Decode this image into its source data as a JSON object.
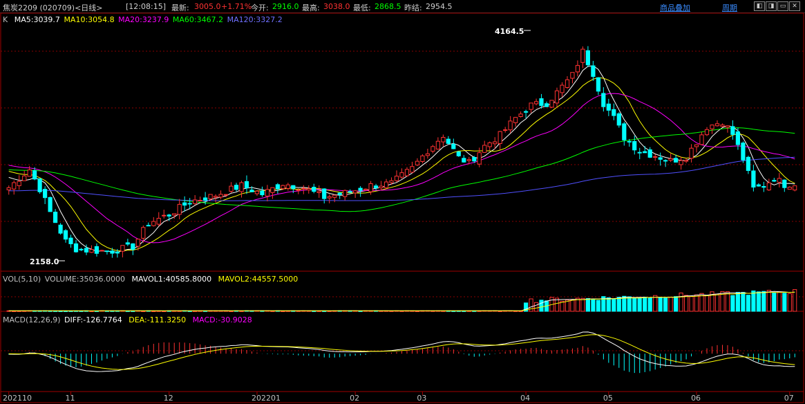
{
  "header": {
    "symbol": "焦炭2209 (020709)<日线>",
    "time": "[12:08:15]",
    "latest_label": "最新:",
    "latest_value": "3005.0",
    "change": "+1.71%",
    "open_label": "今开:",
    "open_value": "2916.0",
    "high_label": "最高:",
    "high_value": "3038.0",
    "low_label": "最低:",
    "low_value": "2868.5",
    "prev_label": "昨结:",
    "prev_value": "2954.5",
    "overlay_button": "商品叠加",
    "period_button": "周期",
    "window_buttons": [
      "◧",
      "◨",
      "▭",
      "✕"
    ]
  },
  "colors": {
    "up": "#ff3232",
    "down": "#00ffff",
    "ma5": "#ffffff",
    "ma10": "#ffff00",
    "ma20": "#ff00ff",
    "ma60": "#00ff00",
    "ma120": "#5050ff",
    "grid": "#8b0000"
  },
  "main_legend": {
    "k": "K",
    "ma5": "MA5:3039.7",
    "ma10": "MA10:3054.8",
    "ma20": "MA20:3237.9",
    "ma60": "MA60:3467.2",
    "ma120": "MA120:3327.2"
  },
  "vol_legend": {
    "name": "VOL(5,10)",
    "volume": "VOLUME:35036.0000",
    "mavol1": "MAVOL1:40585.8000",
    "mavol2": "MAVOL2:44557.5000"
  },
  "macd_legend": {
    "name": "MACD(12,26,9)",
    "diff": "DIFF:-126.7764",
    "dea": "DEA:-111.3250",
    "macd": "MACD:-30.9028"
  },
  "chart_data": {
    "type": "candlestick",
    "price_high_label": "4164.5",
    "price_low_label": "2158.0",
    "ylim": [
      2050,
      4350
    ],
    "x_labels": [
      "202110",
      "11",
      "12",
      "202201",
      "02",
      "03",
      "04",
      "05",
      "06",
      "07"
    ],
    "x_label_index": [
      0,
      12,
      31,
      48,
      67,
      80,
      100,
      116,
      133,
      151
    ],
    "anchors": [
      [
        0,
        2830
      ],
      [
        4,
        3000
      ],
      [
        6,
        2820
      ],
      [
        8,
        2600
      ],
      [
        11,
        2330
      ],
      [
        13,
        2260
      ],
      [
        16,
        2240
      ],
      [
        20,
        2240
      ],
      [
        24,
        2280
      ],
      [
        27,
        2500
      ],
      [
        31,
        2580
      ],
      [
        35,
        2700
      ],
      [
        40,
        2760
      ],
      [
        45,
        2850
      ],
      [
        49,
        2770
      ],
      [
        53,
        2870
      ],
      [
        57,
        2830
      ],
      [
        61,
        2740
      ],
      [
        66,
        2790
      ],
      [
        70,
        2850
      ],
      [
        74,
        2870
      ],
      [
        78,
        3010
      ],
      [
        81,
        3180
      ],
      [
        84,
        3320
      ],
      [
        87,
        3110
      ],
      [
        89,
        3060
      ],
      [
        92,
        3220
      ],
      [
        95,
        3320
      ],
      [
        98,
        3480
      ],
      [
        101,
        3600
      ],
      [
        104,
        3620
      ],
      [
        106,
        3720
      ],
      [
        109,
        3880
      ],
      [
        111,
        4100
      ],
      [
        113,
        3900
      ],
      [
        115,
        3620
      ],
      [
        117,
        3480
      ],
      [
        119,
        3300
      ],
      [
        122,
        3170
      ],
      [
        125,
        3130
      ],
      [
        128,
        3080
      ],
      [
        131,
        3120
      ],
      [
        133,
        3260
      ],
      [
        135,
        3400
      ],
      [
        138,
        3450
      ],
      [
        140,
        3330
      ],
      [
        142,
        3100
      ],
      [
        144,
        2820
      ],
      [
        146,
        2850
      ],
      [
        148,
        2920
      ],
      [
        150,
        2860
      ],
      [
        152,
        2870
      ]
    ],
    "volume_ylim": [
      0,
      70000
    ],
    "macd_ylim": [
      -380,
      300
    ]
  }
}
